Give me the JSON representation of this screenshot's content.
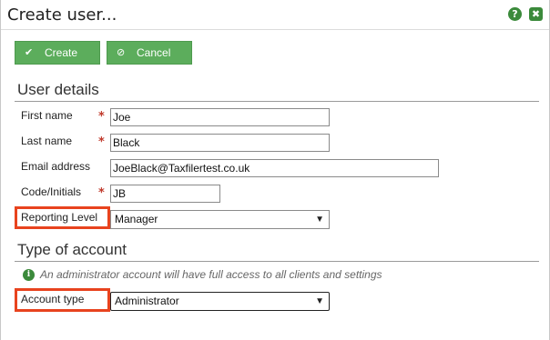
{
  "dialog": {
    "title": "Create user...",
    "help_icon": "question-icon",
    "help_glyph": "?",
    "close_icon": "close-icon",
    "close_glyph": "✖"
  },
  "toolbar": {
    "create_label": "Create",
    "create_icon_glyph": "✔",
    "cancel_label": "Cancel",
    "cancel_icon_glyph": "⊘"
  },
  "user_details": {
    "heading": "User details",
    "first_name": {
      "label": "First name",
      "value": "Joe",
      "required": true
    },
    "last_name": {
      "label": "Last name",
      "value": "Black",
      "required": true
    },
    "email": {
      "label": "Email address",
      "value": "JoeBlack@Taxfilertest.co.uk",
      "required": false
    },
    "code": {
      "label": "Code/Initials",
      "value": "JB",
      "required": true
    },
    "reporting_level": {
      "label": "Reporting Level",
      "value": "Manager"
    },
    "required_marker": "*"
  },
  "account": {
    "heading": "Type of account",
    "info_glyph": "i",
    "info_text": "An administrator account will have full access to all clients and settings",
    "account_type": {
      "label": "Account type",
      "value": "Administrator"
    }
  },
  "colors": {
    "button_green": "#5cad5c",
    "highlight_red": "#e8431e",
    "required_red": "#c0392b"
  }
}
